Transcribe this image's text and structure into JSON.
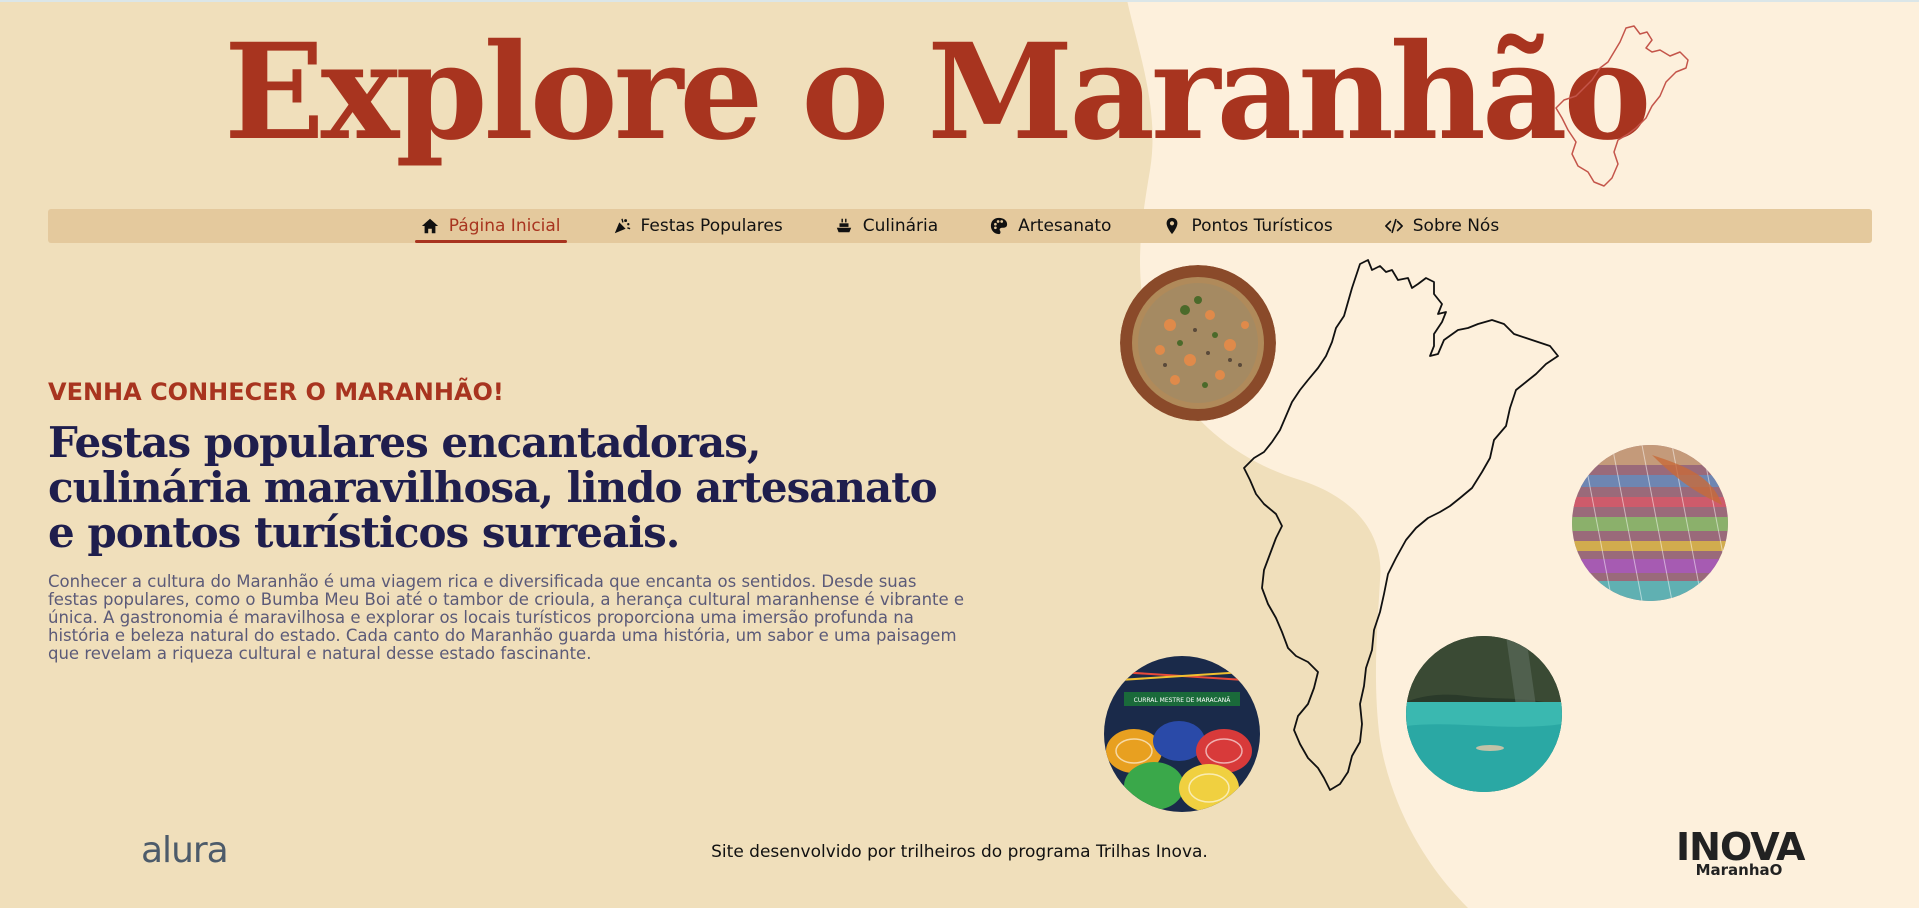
{
  "colors": {
    "background": "#f0dfbb",
    "background_light": "#fdf0dc",
    "nav_background": "#e4c99d",
    "accent": "#a8341f",
    "heading": "#1f1e4d",
    "body_text": "#5b5a78"
  },
  "header": {
    "title": "Explore o Maranhão",
    "map_icon": "maranhao-outline-icon"
  },
  "nav": {
    "items": [
      {
        "label": "Página Inicial",
        "icon": "home-icon",
        "active": true
      },
      {
        "label": "Festas Populares",
        "icon": "party-popper-icon",
        "active": false
      },
      {
        "label": "Culinária",
        "icon": "food-icon",
        "active": false
      },
      {
        "label": "Artesanato",
        "icon": "palette-icon",
        "active": false
      },
      {
        "label": "Pontos Turísticos",
        "icon": "location-pin-icon",
        "active": false
      },
      {
        "label": "Sobre Nós",
        "icon": "code-icon",
        "active": false
      }
    ]
  },
  "hero": {
    "eyebrow": "VENHA CONHECER O MARANHÃO!",
    "heading": "Festas populares encantadoras, culinária maravilhosa, lindo artesanato e pontos turísticos surreais.",
    "body": "Conhecer a cultura do Maranhão é uma viagem rica e diversificada que encanta os sentidos. Desde suas festas populares, como o Bumba Meu Boi até o tambor de crioula, a herança cultural maranhense é vibrante e única. A gastronomia é maravilhosa e explorar os locais turísticos proporciona uma imersão profunda na história e beleza natural do estado. Cada canto do Maranhão guarda uma história, um sabor e uma paisagem que revelam a riqueza cultural e natural desse estado fascinante."
  },
  "gallery": {
    "photos": [
      {
        "name": "culinaria-photo",
        "subject": "rice dish with shrimp in clay bowl"
      },
      {
        "name": "artesanato-photo",
        "subject": "colorful handcrafted textiles"
      },
      {
        "name": "festas-photo",
        "subject": "bumba meu boi colorful hats at festival"
      },
      {
        "name": "pontos-turisticos-photo",
        "subject": "turquoise river pool with cliffs"
      }
    ],
    "photo_banner_text": "CURRAL MESTRE DE MARACANÃ"
  },
  "footer": {
    "left_logo": "alura",
    "text": "Site desenvolvido por trilheiros do programa Trilhas Inova.",
    "right_logo_main": "INOVA",
    "right_logo_sub": "MaranhaO"
  }
}
